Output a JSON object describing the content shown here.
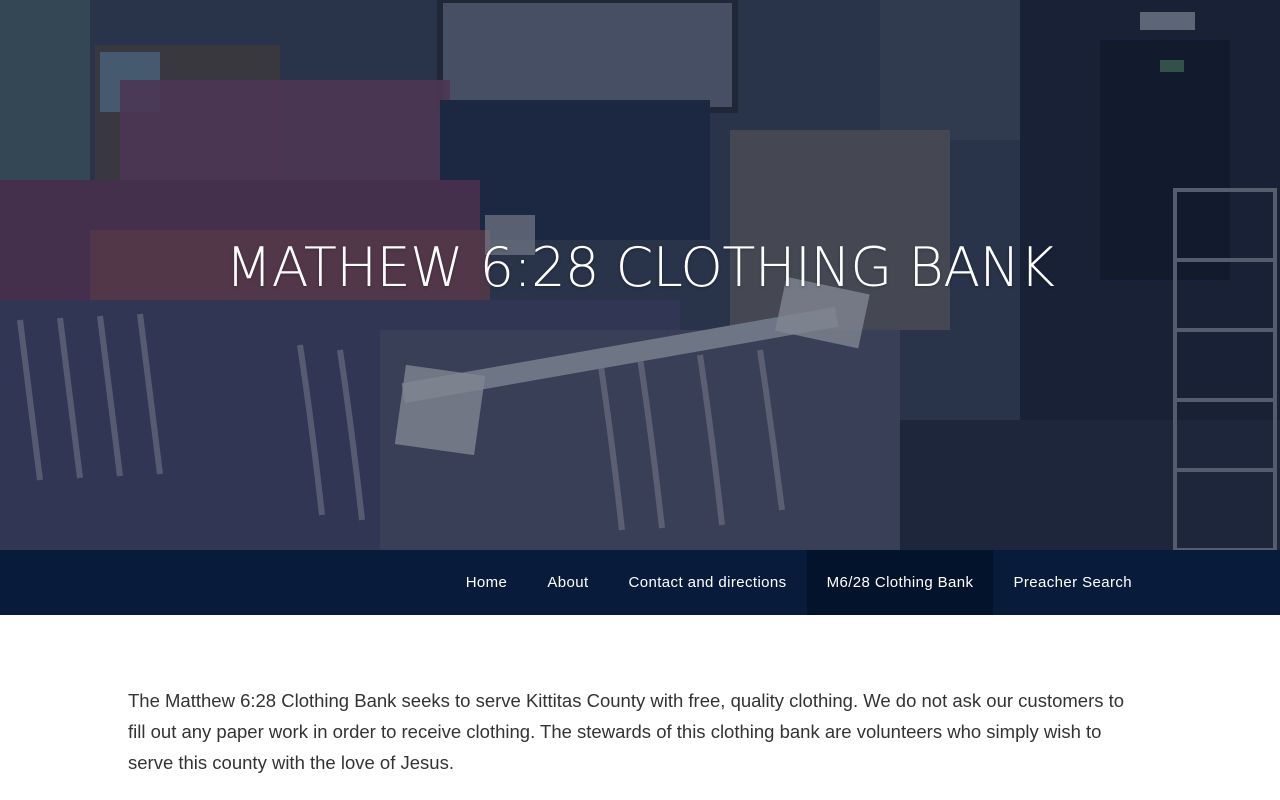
{
  "hero": {
    "title": "MATHEW 6:28 CLOTHING BANK"
  },
  "nav": {
    "items": [
      {
        "label": "Home",
        "active": false
      },
      {
        "label": "About",
        "active": false
      },
      {
        "label": "Contact and directions",
        "active": false
      },
      {
        "label": "M6/28 Clothing Bank",
        "active": true
      },
      {
        "label": "Preacher Search",
        "active": false
      }
    ]
  },
  "content": {
    "paragraph": "The Matthew 6:28 Clothing Bank seeks to serve Kittitas County with free, quality clothing.  We do not ask our customers to fill out any paper work in order to receive clothing. The stewards of this clothing bank are volunteers who simply wish to serve this county with the love of Jesus."
  },
  "colors": {
    "nav_background": "#081b3b",
    "nav_active_background": "#04132c",
    "hero_overlay": "#14203a",
    "body_text": "#333333"
  }
}
